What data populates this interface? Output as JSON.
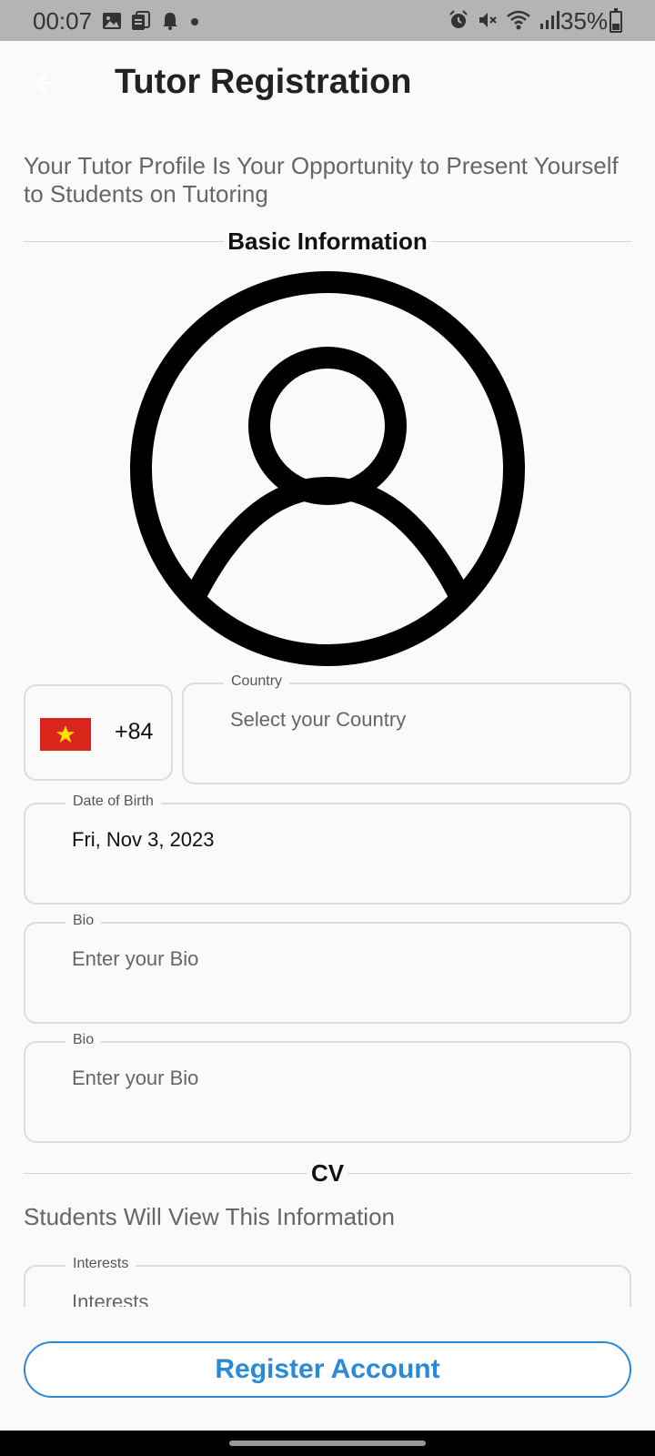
{
  "status_bar": {
    "time": "00:07",
    "battery": "35%",
    "battery_level": 0.35,
    "left_icons": [
      "image-icon",
      "copy-icon",
      "bell-icon",
      "dot-icon"
    ],
    "right_icons": [
      "alarm-icon",
      "mute-icon",
      "wifi-icon",
      "signal-icon"
    ]
  },
  "appbar": {
    "title": "Tutor Registration",
    "back_icon": "arrow-left-icon"
  },
  "intro": "Your Tutor Profile Is Your Opportunity to Present Yourself to Students on Tutoring",
  "sections": {
    "basic": "Basic Information",
    "cv": "CV"
  },
  "avatar_icon": "account-circle-icon",
  "phone": {
    "flag": "vietnam-flag-icon",
    "dial_code": "+84"
  },
  "country": {
    "label": "Country",
    "placeholder": "Select your Country"
  },
  "dob": {
    "label": "Date of Birth",
    "value": "Fri, Nov 3, 2023"
  },
  "bio1": {
    "label": "Bio",
    "placeholder": "Enter your Bio"
  },
  "bio2": {
    "label": "Bio",
    "placeholder": "Enter your Bio"
  },
  "cv_subtitle": "Students Will View This Information",
  "interests": {
    "label": "Interests",
    "placeholder": "Interests"
  },
  "register_button": "Register Account",
  "colors": {
    "accent": "#2a8ad8",
    "status_bar": "#b4b4b4",
    "flag_red": "#da251d",
    "flag_star": "#ffde00"
  }
}
